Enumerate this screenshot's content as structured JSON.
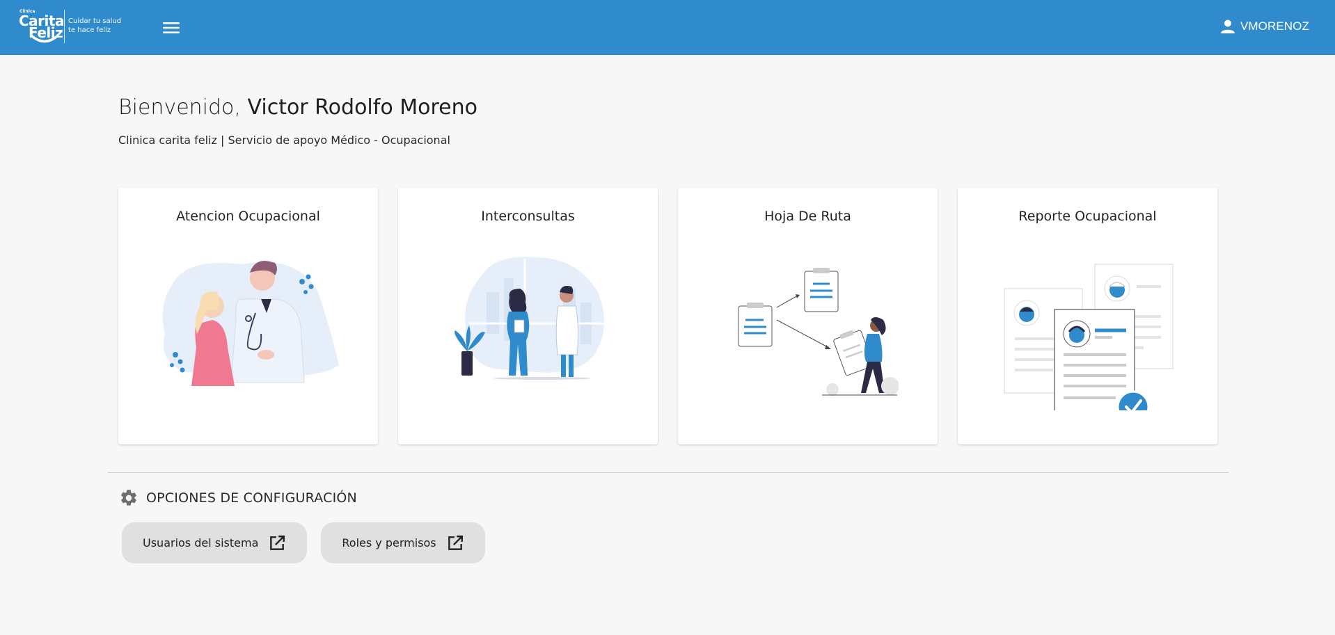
{
  "header": {
    "logo": {
      "small_text": "Clínica",
      "brand_line1": "Carita",
      "brand_line2": "Feliz",
      "tagline_line1": "Cuidar tu salud",
      "tagline_line2": "te hace feliz"
    },
    "menu_icon": "hamburger-menu-icon",
    "user_icon": "person-icon",
    "username": "VMORENOZ",
    "background_color": "#308bcd"
  },
  "welcome": {
    "greeting": "Bienvenido,",
    "user_full_name": "Victor Rodolfo Moreno",
    "subtitle": "Clinica carita feliz | Servicio de apoyo Médico - Ocupacional"
  },
  "cards": [
    {
      "title": "Atencion Ocupacional",
      "illustration": "doctor-patient-illustration"
    },
    {
      "title": "Interconsultas",
      "illustration": "medical-staff-illustration"
    },
    {
      "title": "Hoja De Ruta",
      "illustration": "route-sheet-illustration"
    },
    {
      "title": "Reporte Ocupacional",
      "illustration": "reports-check-illustration"
    }
  ],
  "config": {
    "icon": "gear-icon",
    "title": "OPCIONES DE CONFIGURACIÓN",
    "buttons": [
      {
        "label": "Usuarios del sistema",
        "icon": "open-in-new-icon"
      },
      {
        "label": "Roles y permisos",
        "icon": "open-in-new-icon"
      }
    ]
  },
  "colors": {
    "accent": "#308bcd",
    "pink": "#f07891",
    "button_bg": "#e0e0e0"
  }
}
